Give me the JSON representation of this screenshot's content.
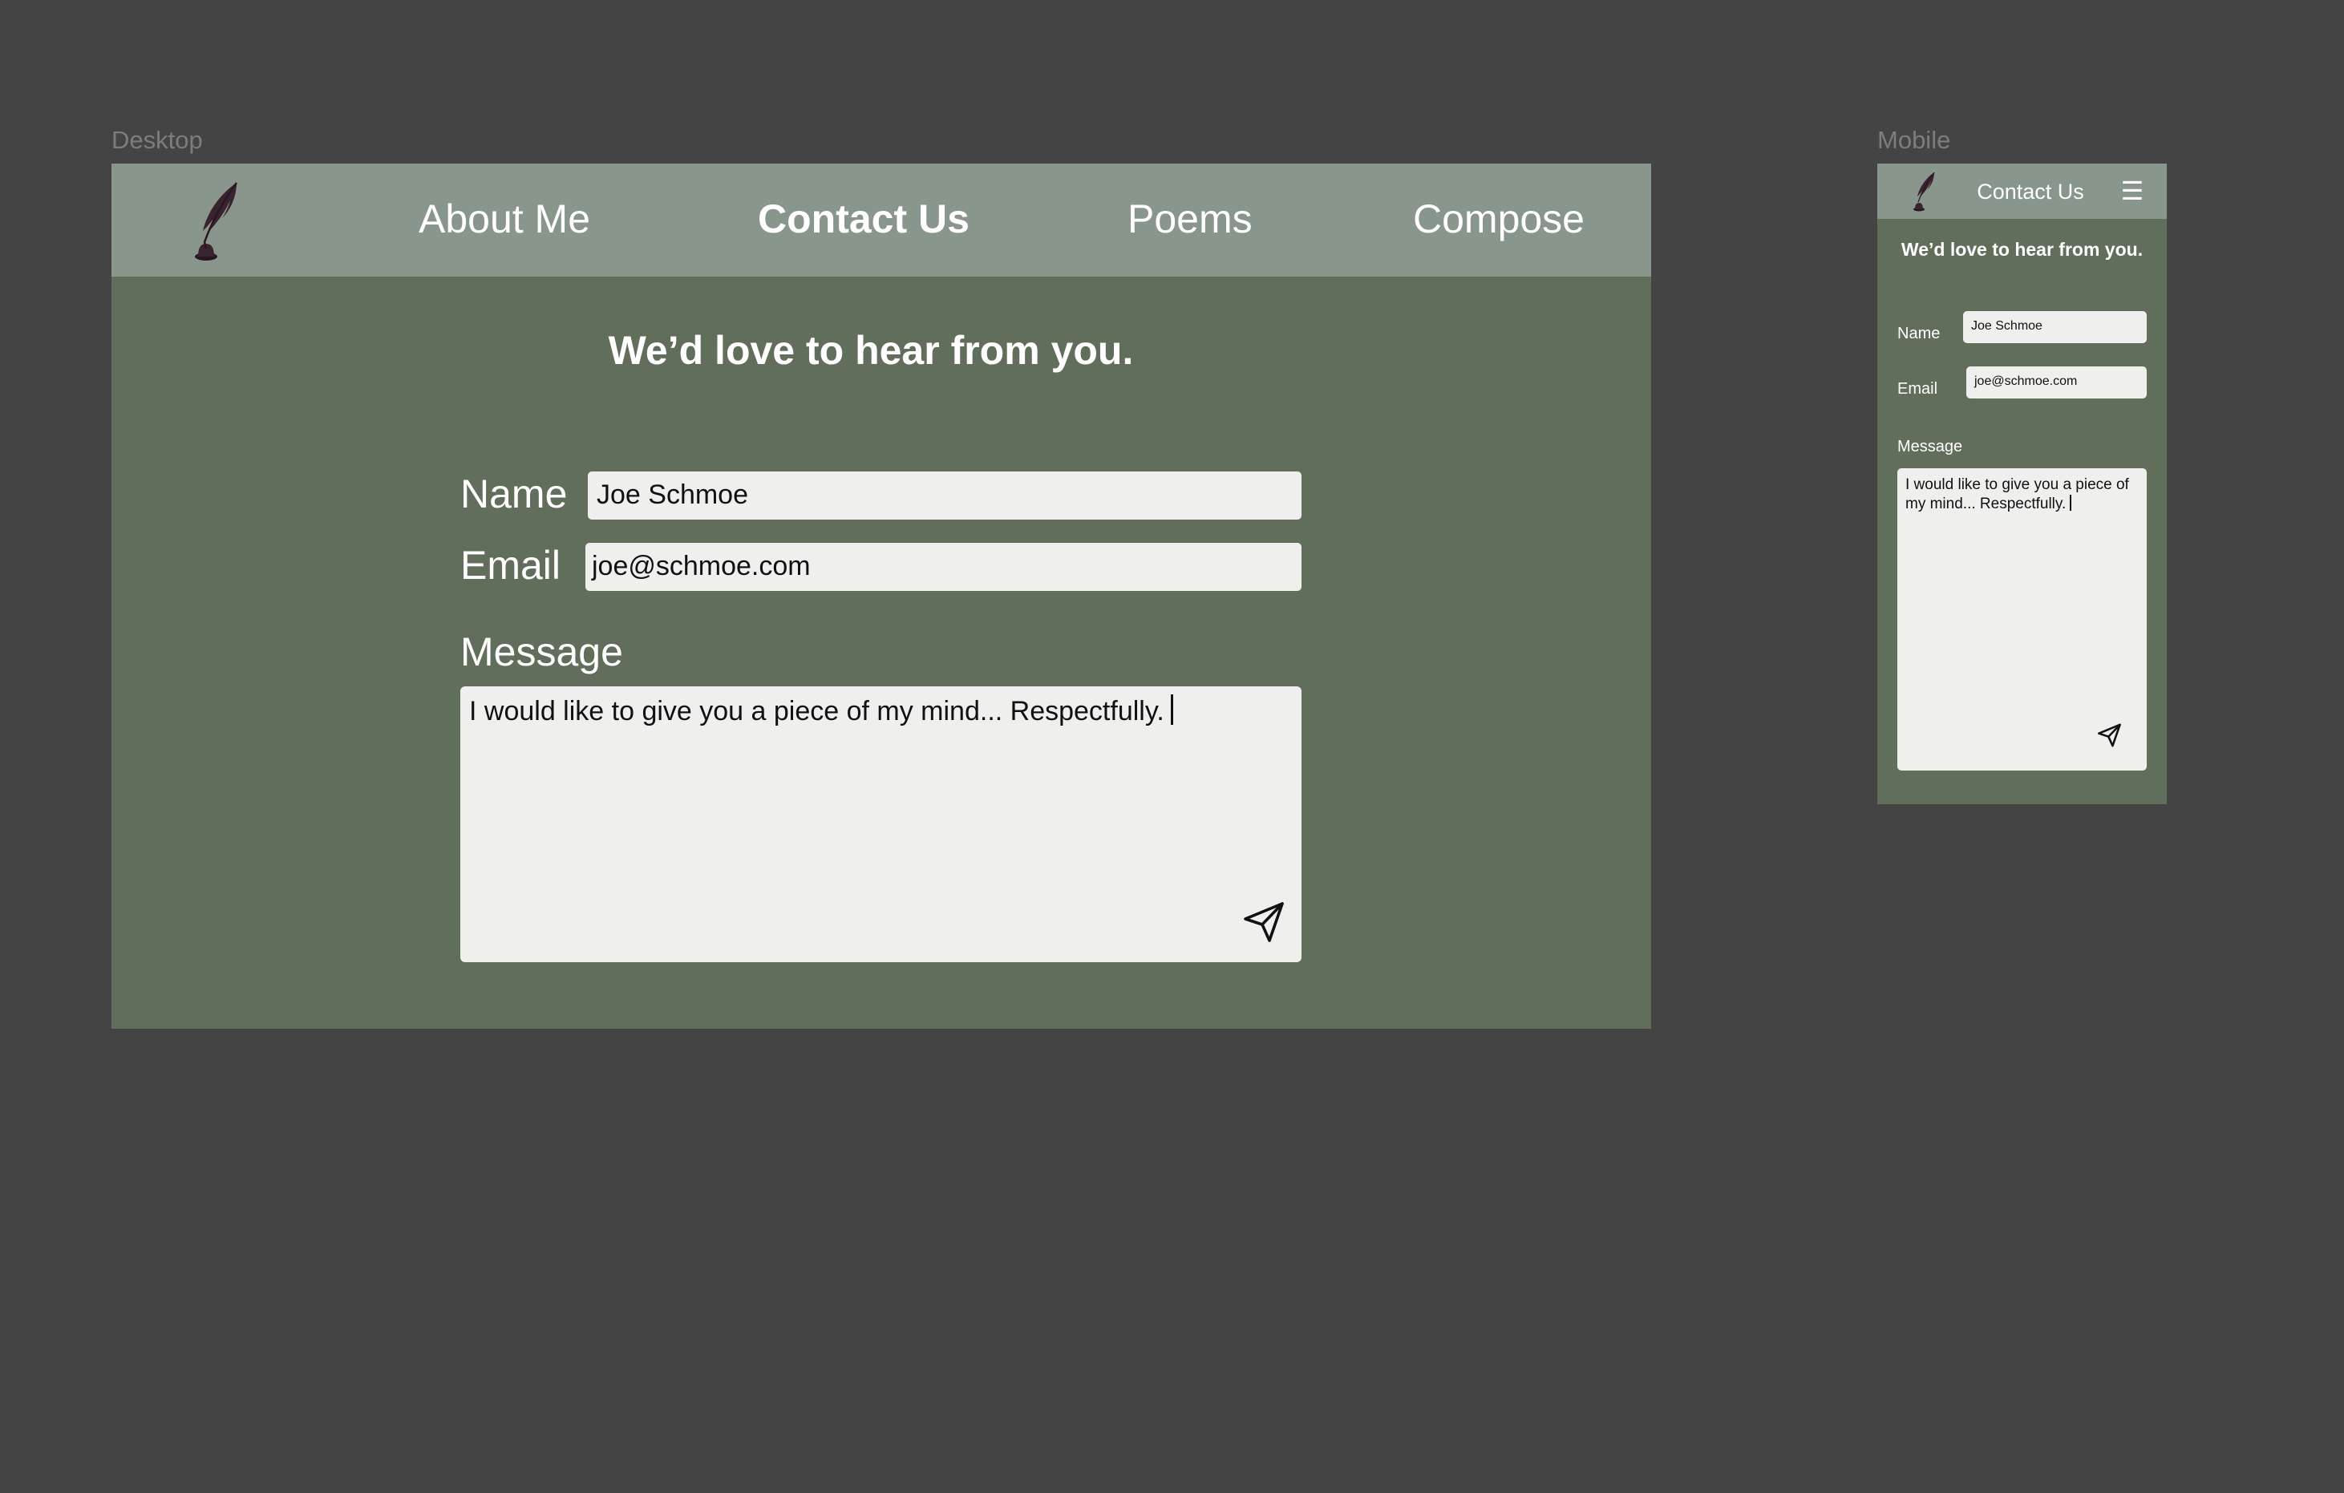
{
  "canvas": {
    "background": "#444444",
    "label_color": "#7d7d7d"
  },
  "theme": {
    "nav_background": "#89968c",
    "page_background": "#626e5c",
    "field_background": "#efefed",
    "text_color": "#ffffff",
    "logo_icon": "quill-pen-icon",
    "send_icon": "paper-plane-icon",
    "menu_icon": "hamburger-menu-icon"
  },
  "desktop": {
    "frame_label": "Desktop",
    "nav": {
      "items": [
        {
          "label": "About Me",
          "active": false
        },
        {
          "label": "Contact Us",
          "active": true
        },
        {
          "label": "Poems",
          "active": false
        },
        {
          "label": "Compose",
          "active": false
        }
      ]
    },
    "heading": "We’d love to hear from you.",
    "form": {
      "name_label": "Name",
      "name_value": "Joe Schmoe",
      "email_label": "Email",
      "email_value": "joe@schmoe.com",
      "message_label": "Message",
      "message_value": "I would like to give you a piece of my mind... Respectfully."
    }
  },
  "mobile": {
    "frame_label": "Mobile",
    "nav": {
      "title": "Contact Us",
      "menu_glyph": "☰"
    },
    "heading": "We’d love to hear from you.",
    "form": {
      "name_label": "Name",
      "name_value": "Joe Schmoe",
      "email_label": "Email",
      "email_value": "joe@schmoe.com",
      "message_label": "Message",
      "message_value": "I would like to give you a piece of my mind... Respectfully."
    }
  }
}
